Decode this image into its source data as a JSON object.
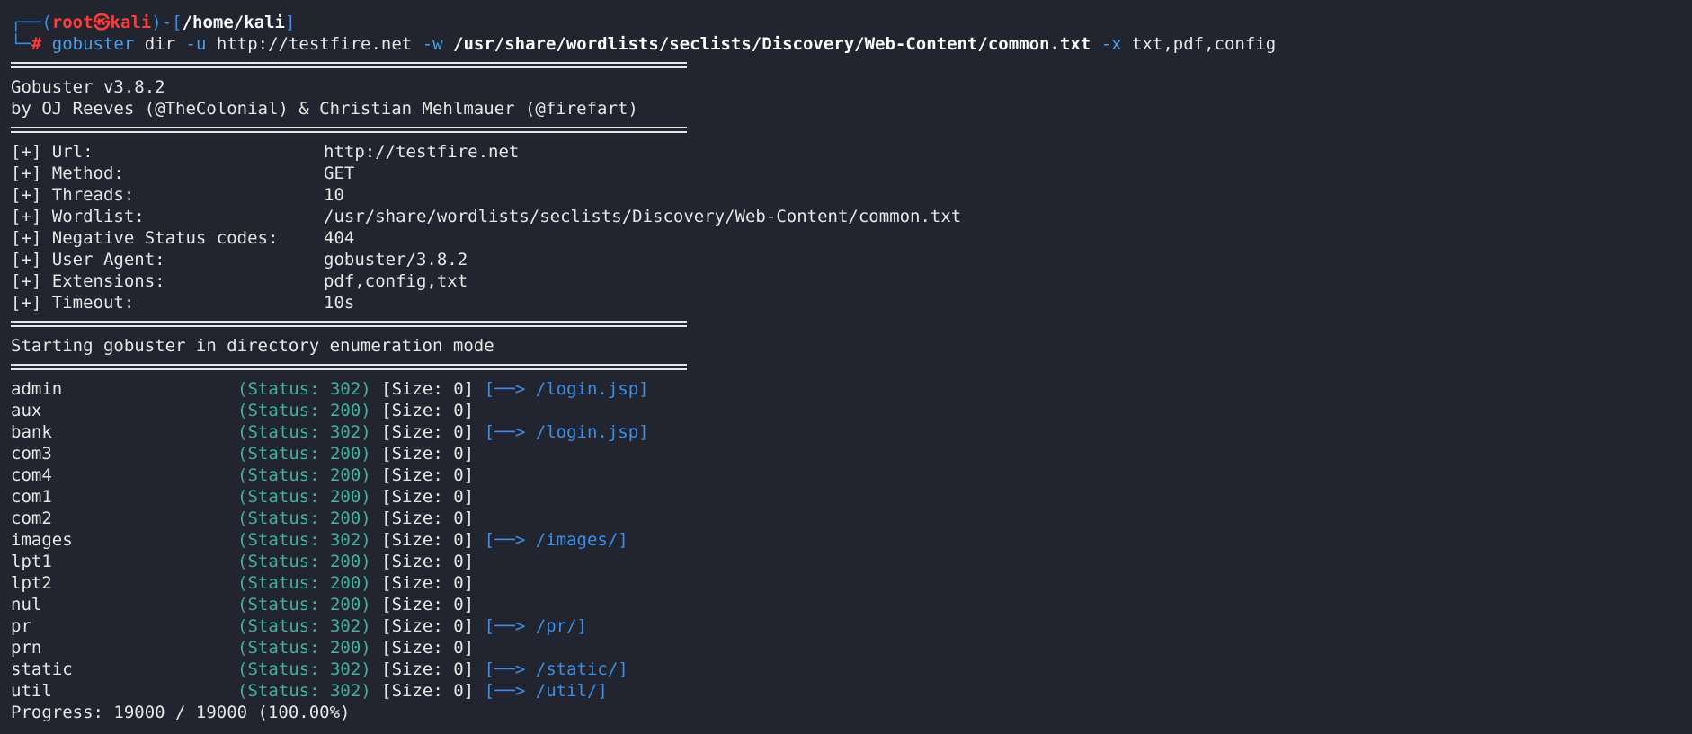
{
  "prompt": {
    "box_top": "┌──(",
    "user": "root㉿kali",
    "mid": ")-[",
    "path": "/home/kali",
    "end": "]",
    "box_bottom": "└─",
    "hash": "#"
  },
  "command": {
    "program": "gobuster",
    "args1": "dir",
    "flag_u": "-u",
    "url": "http://testfire.net",
    "flag_w": "-w",
    "wordlist": "/usr/share/wordlists/seclists/Discovery/Web-Content/common.txt",
    "flag_x": "-x",
    "extensions": "txt,pdf,config"
  },
  "banner": {
    "version": "Gobuster v3.8.2",
    "authors": "by OJ Reeves (@TheColonial) & Christian Mehlmauer (@firefart)"
  },
  "config": [
    {
      "label": "[+] Url:",
      "value": "http://testfire.net"
    },
    {
      "label": "[+] Method:",
      "value": "GET"
    },
    {
      "label": "[+] Threads:",
      "value": "10"
    },
    {
      "label": "[+] Wordlist:",
      "value": "/usr/share/wordlists/seclists/Discovery/Web-Content/common.txt"
    },
    {
      "label": "[+] Negative Status codes:",
      "value": "404"
    },
    {
      "label": "[+] User Agent:",
      "value": "gobuster/3.8.2"
    },
    {
      "label": "[+] Extensions:",
      "value": "pdf,config,txt"
    },
    {
      "label": "[+] Timeout:",
      "value": "10s"
    }
  ],
  "mode_message": "Starting gobuster in directory enumeration mode",
  "results": [
    {
      "name": "admin",
      "status": "(Status: 302)",
      "size": "[Size: 0]",
      "redirect": "[──> /login.jsp]"
    },
    {
      "name": "aux",
      "status": "(Status: 200)",
      "size": "[Size: 0]",
      "redirect": ""
    },
    {
      "name": "bank",
      "status": "(Status: 302)",
      "size": "[Size: 0]",
      "redirect": "[──> /login.jsp]"
    },
    {
      "name": "com3",
      "status": "(Status: 200)",
      "size": "[Size: 0]",
      "redirect": ""
    },
    {
      "name": "com4",
      "status": "(Status: 200)",
      "size": "[Size: 0]",
      "redirect": ""
    },
    {
      "name": "com1",
      "status": "(Status: 200)",
      "size": "[Size: 0]",
      "redirect": ""
    },
    {
      "name": "com2",
      "status": "(Status: 200)",
      "size": "[Size: 0]",
      "redirect": ""
    },
    {
      "name": "images",
      "status": "(Status: 302)",
      "size": "[Size: 0]",
      "redirect": "[──> /images/]"
    },
    {
      "name": "lpt1",
      "status": "(Status: 200)",
      "size": "[Size: 0]",
      "redirect": ""
    },
    {
      "name": "lpt2",
      "status": "(Status: 200)",
      "size": "[Size: 0]",
      "redirect": ""
    },
    {
      "name": "nul",
      "status": "(Status: 200)",
      "size": "[Size: 0]",
      "redirect": ""
    },
    {
      "name": "pr",
      "status": "(Status: 302)",
      "size": "[Size: 0]",
      "redirect": "[──> /pr/]"
    },
    {
      "name": "prn",
      "status": "(Status: 200)",
      "size": "[Size: 0]",
      "redirect": ""
    },
    {
      "name": "static",
      "status": "(Status: 302)",
      "size": "[Size: 0]",
      "redirect": "[──> /static/]"
    },
    {
      "name": "util",
      "status": "(Status: 302)",
      "size": "[Size: 0]",
      "redirect": "[──> /util/]"
    }
  ],
  "progress": "Progress: 19000 / 19000 (100.00%)",
  "colors": {
    "background": "#22252f",
    "foreground": "#e6e6e6",
    "prompt_frame": "#3a8fe8",
    "prompt_user": "#ff3b3b",
    "status": "#3fb39c",
    "redirect": "#3a8fe8"
  }
}
